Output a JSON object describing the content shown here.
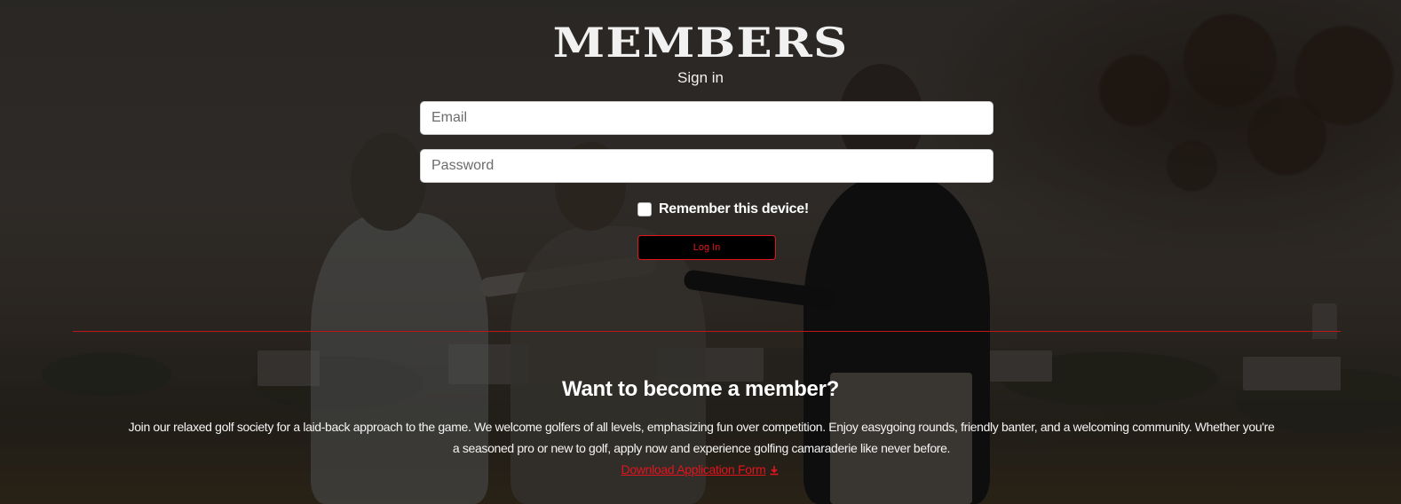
{
  "header": {
    "logo_text": "MEMBERS",
    "subtitle": "Sign in"
  },
  "login_form": {
    "email_placeholder": "Email",
    "password_placeholder": "Password",
    "remember_label": "Remember this device!",
    "remember_checked": false,
    "submit_label": "Log In"
  },
  "membership": {
    "title": "Want to become a member?",
    "description": "Join our relaxed golf society for a laid-back approach to the game. We welcome golfers of all levels, emphasizing fun over competition. Enjoy easygoing rounds, friendly banter, and a welcoming community. Whether you're a seasoned pro or new to golf, apply now and experience golfing camaraderie like never before.",
    "download_link_label": "Download Application Form",
    "download_icon": "download-icon"
  },
  "colors": {
    "accent": "#e3141e",
    "text": "#ffffff",
    "button_bg": "#000000"
  }
}
